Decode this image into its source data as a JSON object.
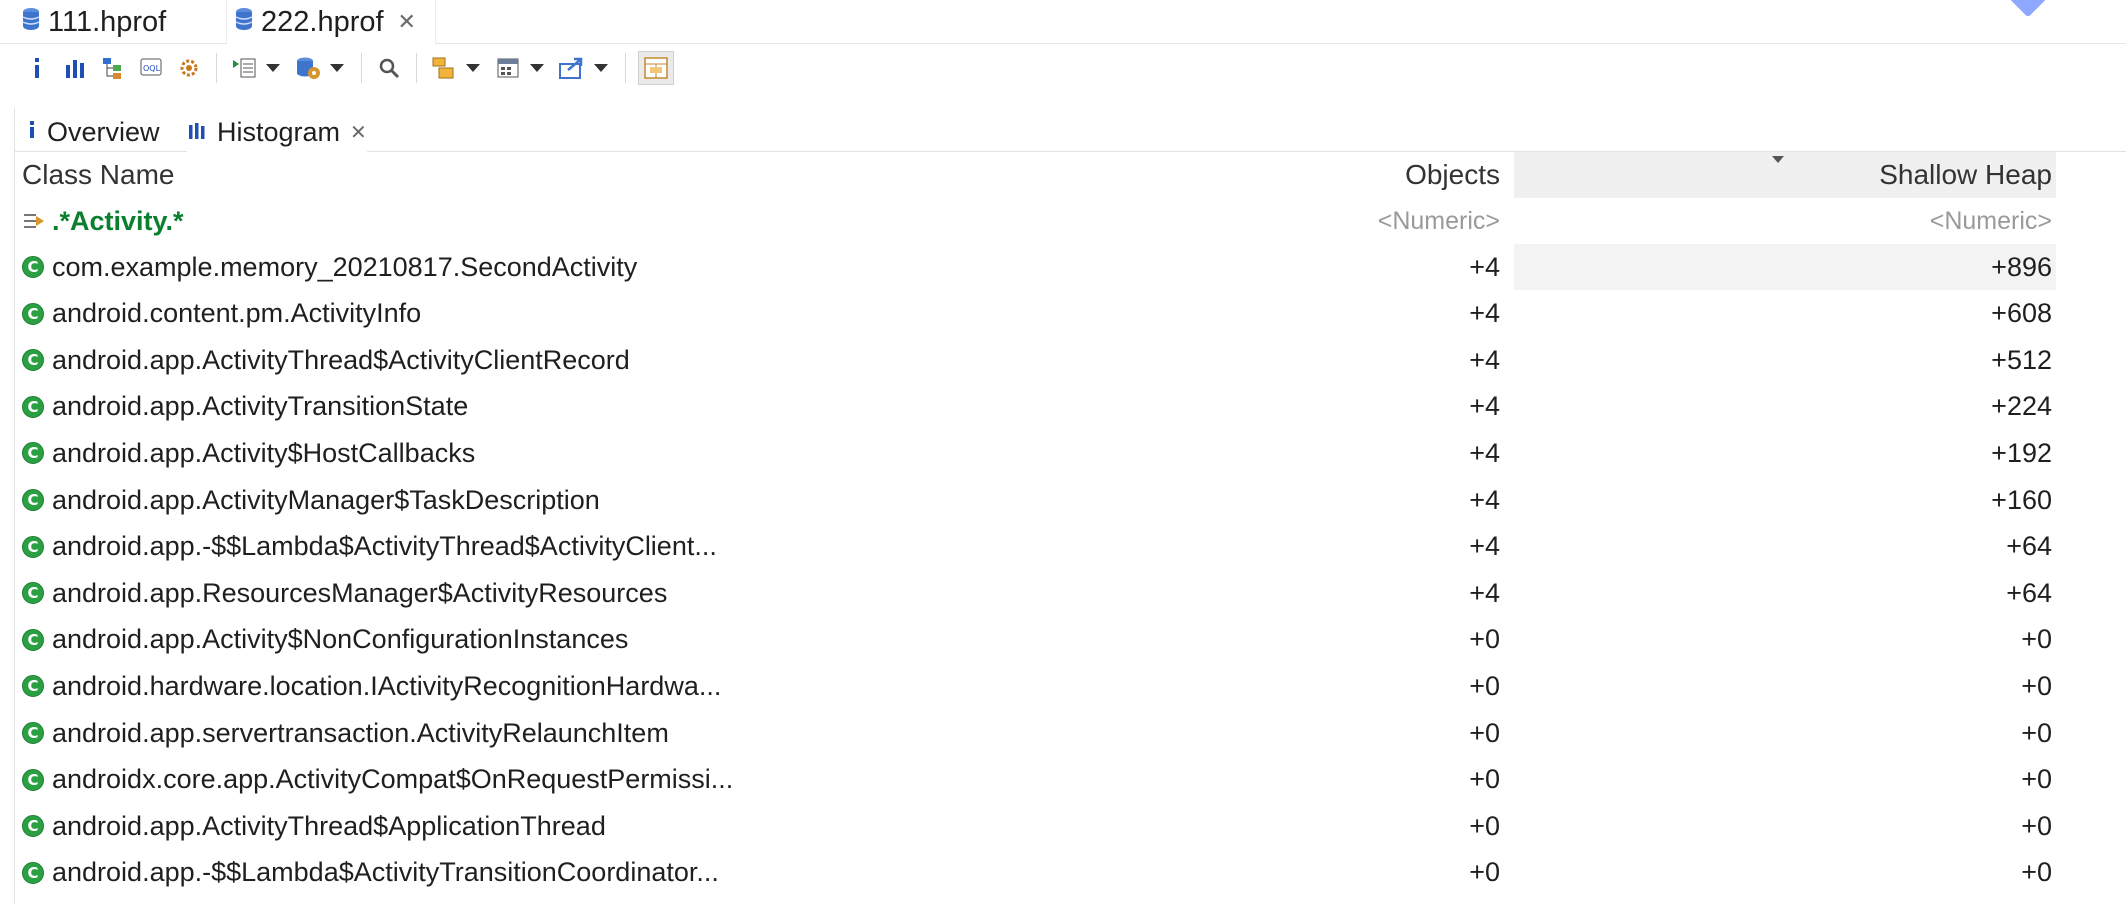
{
  "editor_tabs": [
    {
      "label": "111.hprof"
    },
    {
      "label": "222.hprof"
    }
  ],
  "toolbar": {
    "buttons": [
      "info-icon",
      "histogram-icon",
      "dominator-tree-icon",
      "oql-icon",
      "threads-icon",
      "run-report-icon",
      "heap-dump-actions-icon",
      "search-icon",
      "group-by-icon",
      "calculate-icon",
      "export-icon",
      "layout-toggle-icon"
    ]
  },
  "inner_tabs": [
    {
      "label": "Overview"
    },
    {
      "label": "Histogram"
    }
  ],
  "table": {
    "headers": {
      "class_name": "Class Name",
      "objects": "Objects",
      "shallow_heap": "Shallow Heap"
    },
    "filter": {
      "class_name": ".*Activity.*",
      "objects": "<Numeric>",
      "shallow_heap": "<Numeric>"
    },
    "rows": [
      {
        "class_name": "com.example.memory_20210817.SecondActivity",
        "objects": "+4",
        "shallow_heap": "+896"
      },
      {
        "class_name": "android.content.pm.ActivityInfo",
        "objects": "+4",
        "shallow_heap": "+608"
      },
      {
        "class_name": "android.app.ActivityThread$ActivityClientRecord",
        "objects": "+4",
        "shallow_heap": "+512"
      },
      {
        "class_name": "android.app.ActivityTransitionState",
        "objects": "+4",
        "shallow_heap": "+224"
      },
      {
        "class_name": "android.app.Activity$HostCallbacks",
        "objects": "+4",
        "shallow_heap": "+192"
      },
      {
        "class_name": "android.app.ActivityManager$TaskDescription",
        "objects": "+4",
        "shallow_heap": "+160"
      },
      {
        "class_name": "android.app.-$$Lambda$ActivityThread$ActivityClient...",
        "objects": "+4",
        "shallow_heap": "+64"
      },
      {
        "class_name": "android.app.ResourcesManager$ActivityResources",
        "objects": "+4",
        "shallow_heap": "+64"
      },
      {
        "class_name": "android.app.Activity$NonConfigurationInstances",
        "objects": "+0",
        "shallow_heap": "+0"
      },
      {
        "class_name": "android.hardware.location.IActivityRecognitionHardwa...",
        "objects": "+0",
        "shallow_heap": "+0"
      },
      {
        "class_name": "android.app.servertransaction.ActivityRelaunchItem",
        "objects": "+0",
        "shallow_heap": "+0"
      },
      {
        "class_name": "androidx.core.app.ActivityCompat$OnRequestPermissi...",
        "objects": "+0",
        "shallow_heap": "+0"
      },
      {
        "class_name": "android.app.ActivityThread$ApplicationThread",
        "objects": "+0",
        "shallow_heap": "+0"
      },
      {
        "class_name": "android.app.-$$Lambda$ActivityTransitionCoordinator...",
        "objects": "+0",
        "shallow_heap": "+0"
      }
    ]
  },
  "colors": {
    "class_icon": "#2aa043",
    "filter_text": "#0a7f2d",
    "toolbar_blue": "#1f4fb4"
  }
}
